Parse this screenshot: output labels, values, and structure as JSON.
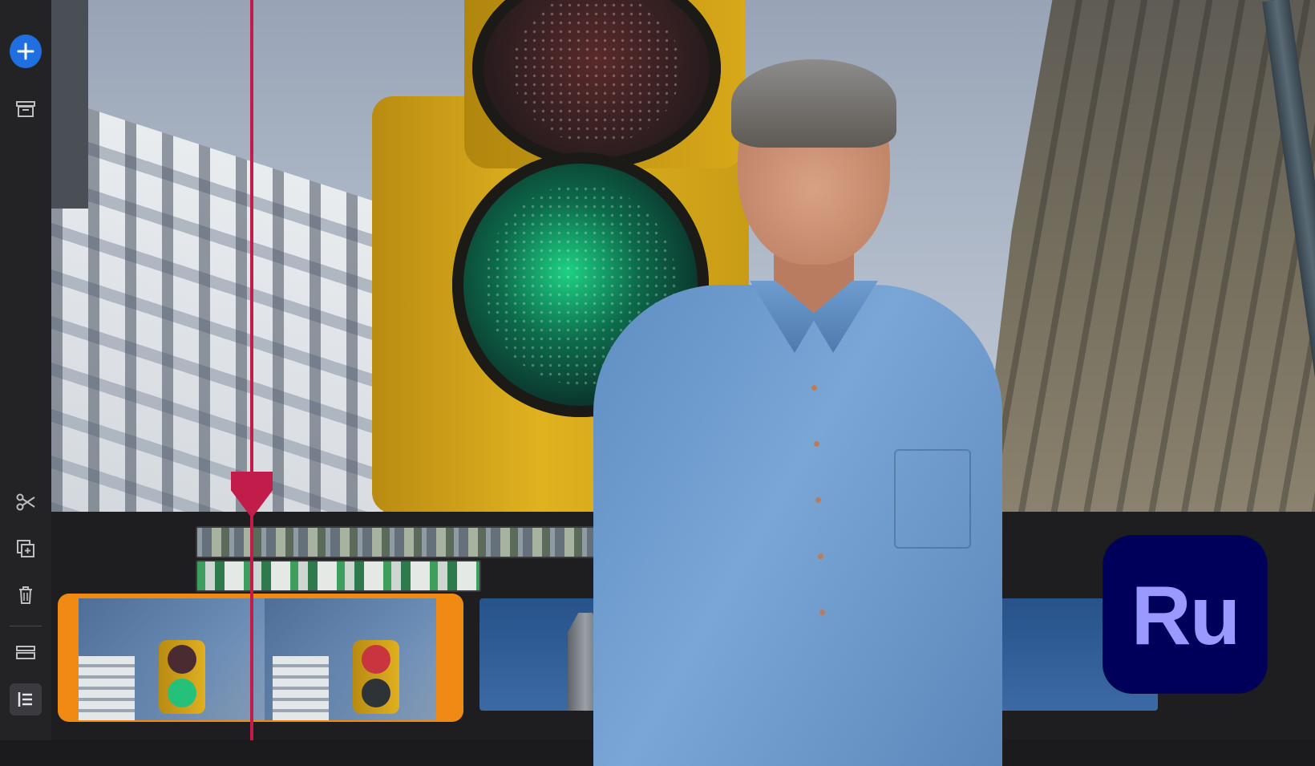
{
  "app": {
    "logo_text": "Ru",
    "accent_color": "#1f6fe0",
    "selection_color": "#f08a12",
    "playhead_color": "#c21d4a",
    "logo_bg": "#00005b",
    "logo_fg": "#9999ff"
  },
  "sidebar": {
    "tools": [
      {
        "id": "add",
        "icon": "plus-icon"
      },
      {
        "id": "archive",
        "icon": "archive-icon"
      },
      {
        "id": "cut",
        "icon": "scissors-icon"
      },
      {
        "id": "duplicate",
        "icon": "duplicate-icon"
      },
      {
        "id": "delete",
        "icon": "trash-icon"
      },
      {
        "id": "strip",
        "icon": "filmstrip-icon"
      },
      {
        "id": "list",
        "icon": "list-icon",
        "active": true
      }
    ]
  },
  "timeline": {
    "overlay_tracks": 2,
    "clips": [
      {
        "id": "clip-traffic-light",
        "selected": true
      },
      {
        "id": "clip-tower",
        "selected": false
      },
      {
        "id": "clip-end",
        "selected": false
      }
    ]
  }
}
